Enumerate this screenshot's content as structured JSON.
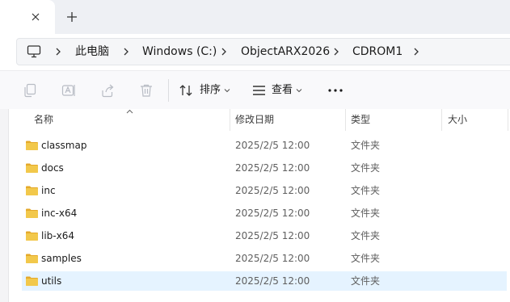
{
  "tabs": {
    "close_icon": "close-icon",
    "new_tab_icon": "plus-icon"
  },
  "address_bar": {
    "root_icon": "computer-icon",
    "crumbs": [
      "此电脑",
      "Windows (C:)",
      "ObjectARX2026",
      "CDROM1"
    ]
  },
  "command_bar": {
    "icons": [
      "copy-icon",
      "rename-icon",
      "share-icon",
      "delete-icon"
    ],
    "sort_label": "排序",
    "view_label": "查看",
    "more_icon": "more-icon"
  },
  "file_list": {
    "columns": {
      "name": "名称",
      "date": "修改日期",
      "type": "类型",
      "size": "大小"
    },
    "sort_indicator": "ascending",
    "rows": [
      {
        "name": "classmap",
        "date": "2025/2/5 12:00",
        "type": "文件夹",
        "selected": false
      },
      {
        "name": "docs",
        "date": "2025/2/5 12:00",
        "type": "文件夹",
        "selected": false
      },
      {
        "name": "inc",
        "date": "2025/2/5 12:00",
        "type": "文件夹",
        "selected": false
      },
      {
        "name": "inc-x64",
        "date": "2025/2/5 12:00",
        "type": "文件夹",
        "selected": false
      },
      {
        "name": "lib-x64",
        "date": "2025/2/5 12:00",
        "type": "文件夹",
        "selected": false
      },
      {
        "name": "samples",
        "date": "2025/2/5 12:00",
        "type": "文件夹",
        "selected": false
      },
      {
        "name": "utils",
        "date": "2025/2/5 12:00",
        "type": "文件夹",
        "selected": true
      }
    ]
  },
  "colors": {
    "folder": "#f2c84b",
    "selection": "#e5f3ff"
  }
}
